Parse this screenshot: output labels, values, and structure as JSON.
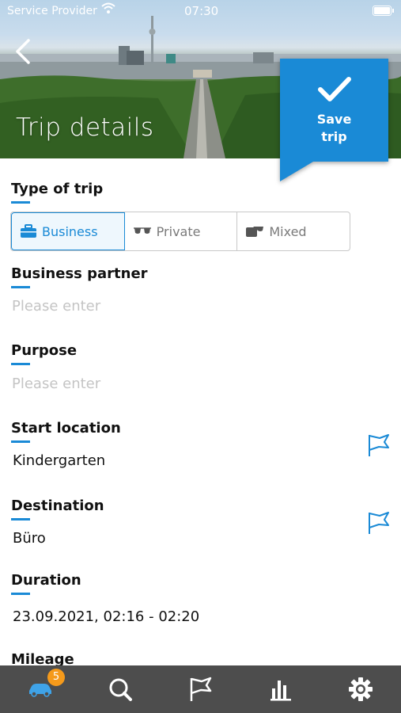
{
  "status_bar": {
    "carrier": "Service Provider",
    "time": "07:30"
  },
  "header": {
    "title": "Trip details",
    "save_label": "Save\ntrip"
  },
  "trip_type": {
    "label": "Type of trip",
    "options": [
      {
        "label": "Business",
        "icon": "briefcase-icon",
        "selected": true
      },
      {
        "label": "Private",
        "icon": "sunglasses-icon",
        "selected": false
      },
      {
        "label": "Mixed",
        "icon": "mixed-icon",
        "selected": false
      }
    ]
  },
  "fields": {
    "business_partner": {
      "label": "Business partner",
      "placeholder": "Please enter"
    },
    "purpose": {
      "label": "Purpose",
      "placeholder": "Please enter"
    },
    "start_location": {
      "label": "Start location",
      "value": "Kindergarten"
    },
    "destination": {
      "label": "Destination",
      "value": "Büro"
    },
    "duration": {
      "label": "Duration",
      "value": "23.09.2021, 02:16 - 02:20"
    },
    "mileage": {
      "label": "Mileage"
    }
  },
  "tab_bar": {
    "items": [
      {
        "name": "trips",
        "icon": "car-icon",
        "badge": "5",
        "active": true
      },
      {
        "name": "search",
        "icon": "search-icon"
      },
      {
        "name": "places",
        "icon": "flag-icon"
      },
      {
        "name": "statistics",
        "icon": "bar-chart-icon"
      },
      {
        "name": "settings",
        "icon": "gear-icon"
      }
    ]
  },
  "colors": {
    "accent": "#1a8ad6",
    "badge": "#f59a1b",
    "tab_bar": "#4d4d4d",
    "placeholder": "#c4c4c4"
  }
}
